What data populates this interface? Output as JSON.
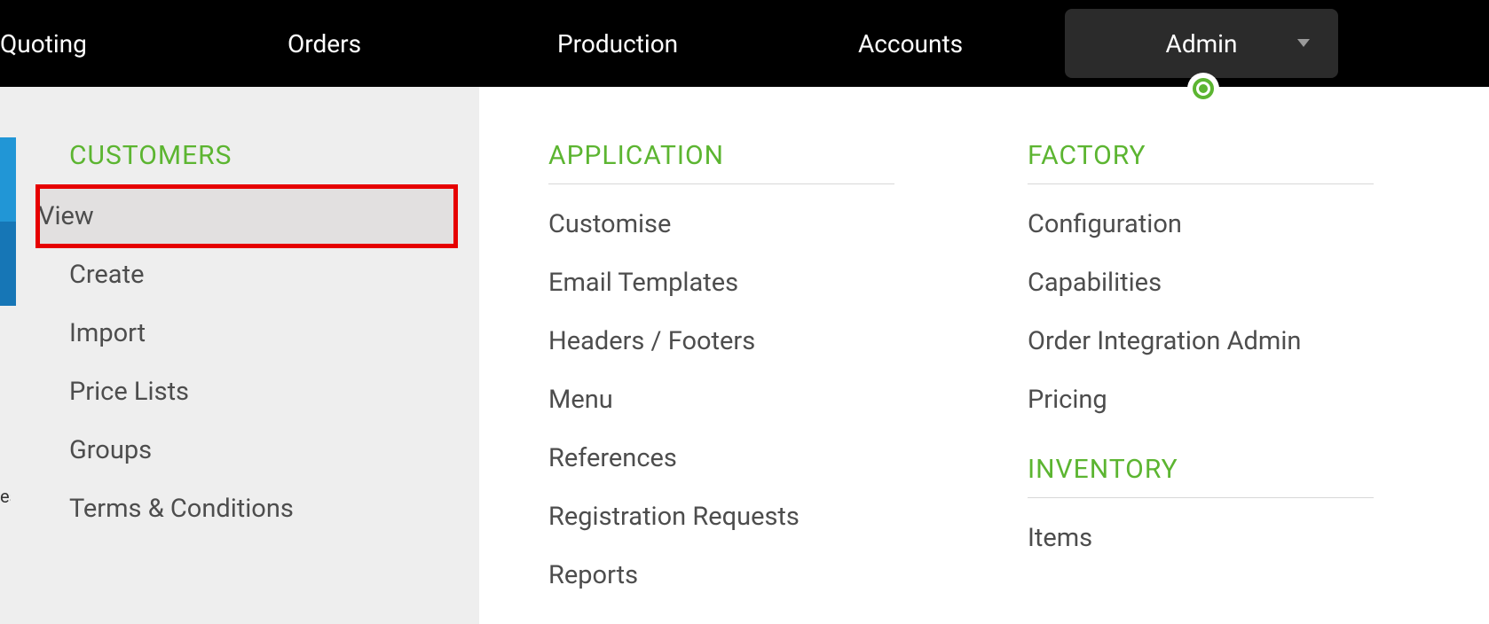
{
  "topnav": {
    "quoting": "Quoting",
    "orders": "Orders",
    "production": "Production",
    "accounts": "Accounts",
    "admin": "Admin"
  },
  "sidebar": {
    "heading": "CUSTOMERS",
    "items": [
      {
        "label": "View"
      },
      {
        "label": "Create"
      },
      {
        "label": "Import"
      },
      {
        "label": "Price Lists"
      },
      {
        "label": "Groups"
      },
      {
        "label": "Terms & Conditions"
      }
    ]
  },
  "application": {
    "heading": "APPLICATION",
    "items": [
      {
        "label": "Customise"
      },
      {
        "label": "Email Templates"
      },
      {
        "label": "Headers / Footers"
      },
      {
        "label": "Menu"
      },
      {
        "label": "References"
      },
      {
        "label": "Registration Requests"
      },
      {
        "label": "Reports"
      }
    ]
  },
  "factory": {
    "heading": "FACTORY",
    "items": [
      {
        "label": "Configuration"
      },
      {
        "label": "Capabilities"
      },
      {
        "label": "Order Integration Admin"
      },
      {
        "label": "Pricing"
      }
    ]
  },
  "inventory": {
    "heading": "INVENTORY",
    "items": [
      {
        "label": "Items"
      }
    ]
  },
  "edge_text": "es"
}
